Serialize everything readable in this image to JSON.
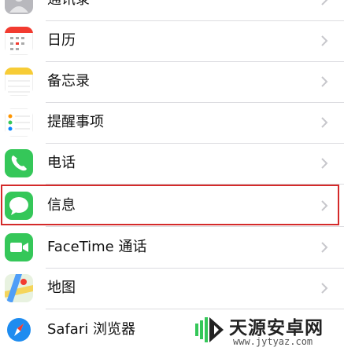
{
  "settings_list": {
    "items": [
      {
        "label": "通讯录",
        "icon": "contacts-icon"
      },
      {
        "label": "日历",
        "icon": "calendar-icon"
      },
      {
        "label": "备忘录",
        "icon": "notes-icon"
      },
      {
        "label": "提醒事项",
        "icon": "reminders-icon"
      },
      {
        "label": "电话",
        "icon": "phone-icon"
      },
      {
        "label": "信息",
        "icon": "messages-icon",
        "highlighted": true
      },
      {
        "label": "FaceTime 通话",
        "icon": "facetime-icon"
      },
      {
        "label": "地图",
        "icon": "maps-icon"
      },
      {
        "label": "Safari 浏览器",
        "icon": "safari-icon"
      }
    ]
  },
  "watermark": {
    "title": "天源安卓网",
    "url": "www.jytyaz.com"
  },
  "colors": {
    "highlight_border": "#d42a2a",
    "green": "#35c759",
    "separator": "#dcdce0",
    "chevron": "#c7c7cc"
  }
}
